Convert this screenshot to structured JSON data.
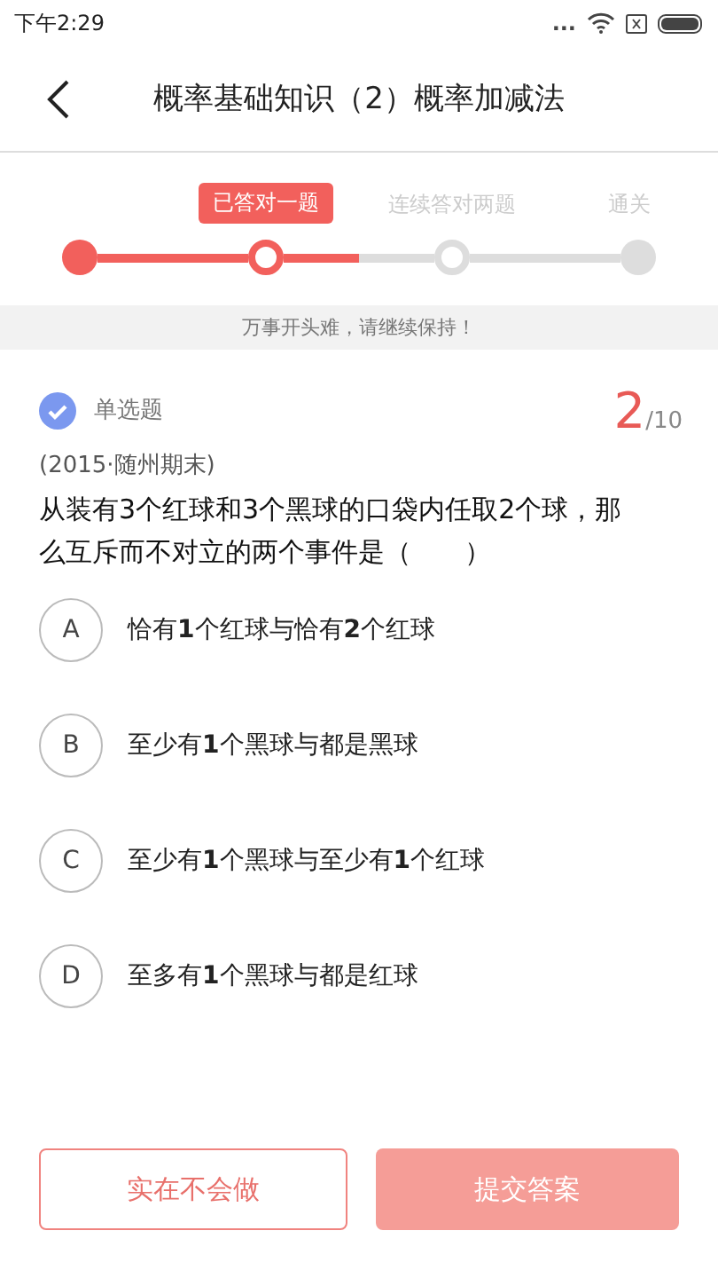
{
  "status_bar": {
    "time": "下午2:29",
    "dots": "..."
  },
  "header": {
    "title": "概率基础知识（2）概率加减法"
  },
  "progress": {
    "steps": [
      {
        "kind": "done"
      },
      {
        "kind": "current",
        "label": "已答对一题"
      },
      {
        "kind": "pending",
        "label": "连续答对两题"
      },
      {
        "kind": "goal",
        "label": "通关"
      }
    ]
  },
  "banner": "万事开头难，请继续保持！",
  "question": {
    "type": "单选题",
    "checked": true,
    "number": "2",
    "total": "/10",
    "source": "(2015·随州期末)",
    "text": "从装有3个红球和3个黑球的口袋内任取2个球，那么互斥而不对立的两个事件是（　　）",
    "options": [
      {
        "letter": "A",
        "text": "恰有**1**个红球与恰有**2**个红球",
        "selected": false
      },
      {
        "letter": "B",
        "text": "至少有**1**个黑球与都是黑球",
        "selected": false
      },
      {
        "letter": "C",
        "text": "至少有**1**个黑球与至少有**1**个红球",
        "selected": false
      },
      {
        "letter": "D",
        "text": "至多有**1**个黑球与都是红球",
        "selected": false
      }
    ]
  },
  "buttons": [
    {
      "label": "实在不会做",
      "kind": "outline",
      "disabled": false
    },
    {
      "label": "提交答案",
      "kind": "solid",
      "disabled": true
    }
  ]
}
